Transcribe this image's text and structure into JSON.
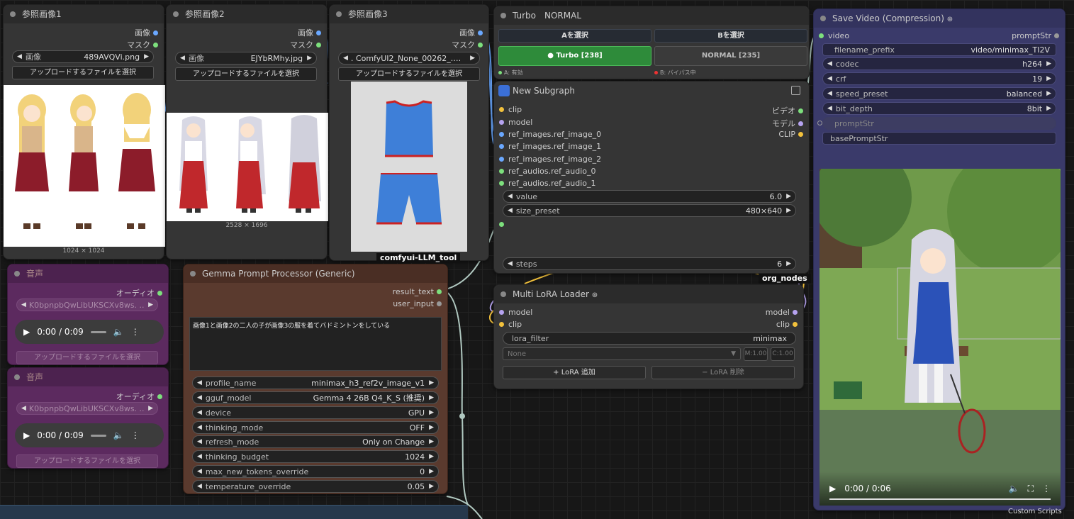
{
  "ref1": {
    "title": "参照画像1",
    "out_image": "画像",
    "out_mask": "マスク",
    "combo_label": "画像",
    "combo_value": "489AVQVi.png",
    "upload": "アップロードするファイルを選択",
    "size": "1024 × 1024"
  },
  "ref2": {
    "title": "参照画像2",
    "out_image": "画像",
    "out_mask": "マスク",
    "combo_label": "画像",
    "combo_value": "EJYbRMhy.jpg",
    "upload": "アップロードするファイルを選択",
    "size": "2528 × 1696"
  },
  "ref3": {
    "title": "参照画像3",
    "out_image": "画像",
    "out_mask": "マスク",
    "combo_value": ". ComfyUI2_None_00262_.png",
    "upload": "アップロードするファイルを選択",
    "group_label": "comfyui-LLM_tool"
  },
  "turbo": {
    "title": "Turbo　NORMAL",
    "btn_a": "Aを選択",
    "btn_b": "Bを選択",
    "btn_turbo": "● Turbo [238]",
    "btn_normal": "NORMAL [235]",
    "state_a": "A: 有効",
    "state_b": "B: バイパス中"
  },
  "subgraph": {
    "title": "New Subgraph",
    "inputs": [
      "clip",
      "model",
      "ref_images.ref_image_0",
      "ref_images.ref_image_1",
      "ref_images.ref_image_2",
      "ref_audios.ref_audio_0",
      "ref_audios.ref_audio_1"
    ],
    "outputs": [
      "ビデオ",
      "モデル",
      "CLIP"
    ],
    "value_label": "value",
    "value": "6.0",
    "size_label": "size_preset",
    "size": "480×640",
    "steps_label": "steps",
    "steps": "6",
    "group_label": "org_nodes"
  },
  "save": {
    "title": "Save Video (Compression)",
    "in_video": "video",
    "out_prompt": "promptStr",
    "widgets": [
      {
        "label": "filename_prefix",
        "value": "video/minimax_TI2V"
      },
      {
        "label": "codec",
        "value": "h264"
      },
      {
        "label": "crf",
        "value": "19"
      },
      {
        "label": "speed_preset",
        "value": "balanced"
      },
      {
        "label": "bit_depth",
        "value": "8bit"
      }
    ],
    "prompt_in": "promptStr",
    "base_prompt": "basePromptStr",
    "time": "0:00 / 0:06",
    "footer": "Custom Scripts"
  },
  "audio1": {
    "title": "音声",
    "out": "オーディオ",
    "combo": "K0bpnpbQwLibUKSCXv8ws. ..",
    "time": "0:00 / 0:09",
    "upload": "アップロードするファイルを選択"
  },
  "audio2": {
    "title": "音声",
    "out": "オーディオ",
    "combo": "K0bpnpbQwLibUKSCXv8ws. ..",
    "time": "0:00 / 0:09",
    "upload": "アップロードするファイルを選択"
  },
  "gemma": {
    "title": "Gemma Prompt Processor (Generic)",
    "out_result": "result_text",
    "in_user": "user_input",
    "prompt": "画像1と画像2の二人の子が画像3の服を着てバドミントンをしている",
    "widgets": [
      {
        "label": "profile_name",
        "value": "minimax_h3_ref2v_image_v1"
      },
      {
        "label": "gguf_model",
        "value": "Gemma 4 26B Q4_K_S (推奨)"
      },
      {
        "label": "device",
        "value": "GPU"
      },
      {
        "label": "thinking_mode",
        "value": "OFF"
      },
      {
        "label": "refresh_mode",
        "value": "Only on Change"
      },
      {
        "label": "thinking_budget",
        "value": "1024"
      },
      {
        "label": "max_new_tokens_override",
        "value": "0"
      },
      {
        "label": "temperature_override",
        "value": "0.05"
      }
    ]
  },
  "lora": {
    "title": "Multi LoRA Loader",
    "in_model": "model",
    "in_clip": "clip",
    "out_model": "model",
    "out_clip": "clip",
    "filter_label": "lora_filter",
    "filter_value": "minimax",
    "none": "None",
    "w1": "1.00",
    "w2": "1.00",
    "add": "+ LoRA 追加",
    "remove": "− LoRA 削除"
  },
  "colors": {
    "turbo_active": "#2e8b3a",
    "audio_node": "#5c2a5f",
    "gemma_node": "#5a3a2e",
    "save_node": "#3a3a6a"
  }
}
